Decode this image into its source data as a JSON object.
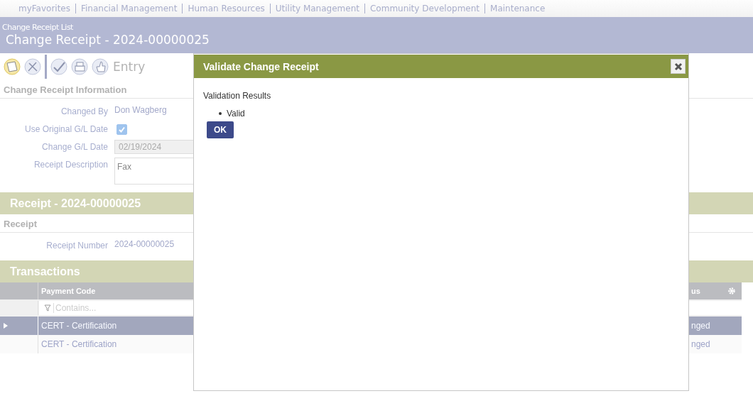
{
  "top_nav": [
    {
      "label": "myFavorites"
    },
    {
      "label": "Financial Management"
    },
    {
      "label": "Human Resources"
    },
    {
      "label": "Utility Management"
    },
    {
      "label": "Community Development"
    },
    {
      "label": "Maintenance"
    }
  ],
  "breadcrumb": "Change Receipt List",
  "page_title": "Change Receipt - 2024-00000025",
  "toolbar": {
    "status": "Entry"
  },
  "change_info": {
    "heading": "Change Receipt Information",
    "fields": [
      {
        "kind": "text",
        "label": "Changed By",
        "value": "Don Wagberg"
      },
      {
        "kind": "checkbox",
        "label": "Use Original G/L Date",
        "checked": true
      },
      {
        "kind": "input",
        "label": "Change G/L Date",
        "value": "02/19/2024",
        "disabled": true
      },
      {
        "kind": "textarea",
        "label": "Receipt Description",
        "value": "Fax"
      }
    ]
  },
  "receipt_band": "Receipt - 2024-00000025",
  "receipt": {
    "heading": "Receipt",
    "fields": [
      {
        "kind": "text",
        "label": "Receipt Number",
        "value": "2024-00000025"
      }
    ]
  },
  "transactions": {
    "title": "Transactions",
    "columns": [
      "Payment Code",
      "us"
    ],
    "filter_placeholder": "Contains...",
    "rows": [
      {
        "selected": true,
        "cells": [
          "CERT - Certification",
          "nged"
        ]
      },
      {
        "selected": false,
        "cells": [
          "CERT - Certification",
          "nged"
        ]
      }
    ]
  },
  "dialog": {
    "title": "Validate Change Receipt",
    "heading": "Validation Results",
    "results": [
      "Valid"
    ],
    "button": "OK"
  }
}
